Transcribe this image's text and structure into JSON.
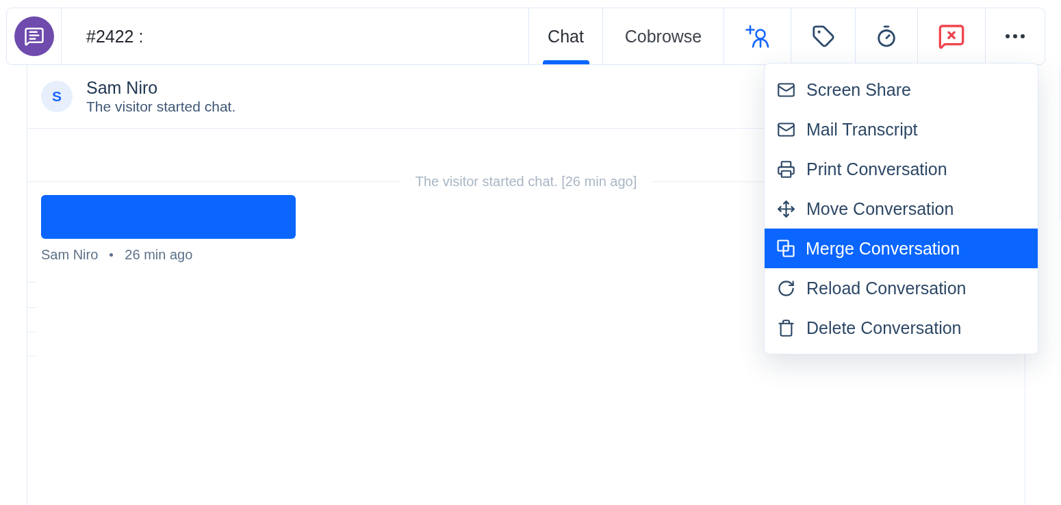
{
  "header": {
    "title": "#2422 :",
    "tabs": [
      {
        "label": "Chat",
        "selected": true
      },
      {
        "label": "Cobrowse",
        "selected": false
      }
    ]
  },
  "visitor": {
    "initial": "S",
    "name": "Sam Niro",
    "status": "The visitor started chat."
  },
  "messages": [
    {
      "kind": "system",
      "text": "The visitor started chat. [26 min ago]"
    },
    {
      "kind": "bubble",
      "author": "Sam Niro",
      "time": "26 min ago"
    }
  ],
  "menu": {
    "items": [
      {
        "kind": "share",
        "label": "Screen Share",
        "selected": false
      },
      {
        "kind": "mail",
        "label": "Mail Transcript",
        "selected": false
      },
      {
        "kind": "print",
        "label": "Print Conversation",
        "selected": false
      },
      {
        "kind": "move",
        "label": "Move Conversation",
        "selected": false
      },
      {
        "kind": "merge",
        "label": "Merge Conversation",
        "selected": true
      },
      {
        "kind": "reload",
        "label": "Reload Conversation",
        "selected": false
      },
      {
        "kind": "delete",
        "label": "Delete Conversation",
        "selected": false
      }
    ]
  }
}
